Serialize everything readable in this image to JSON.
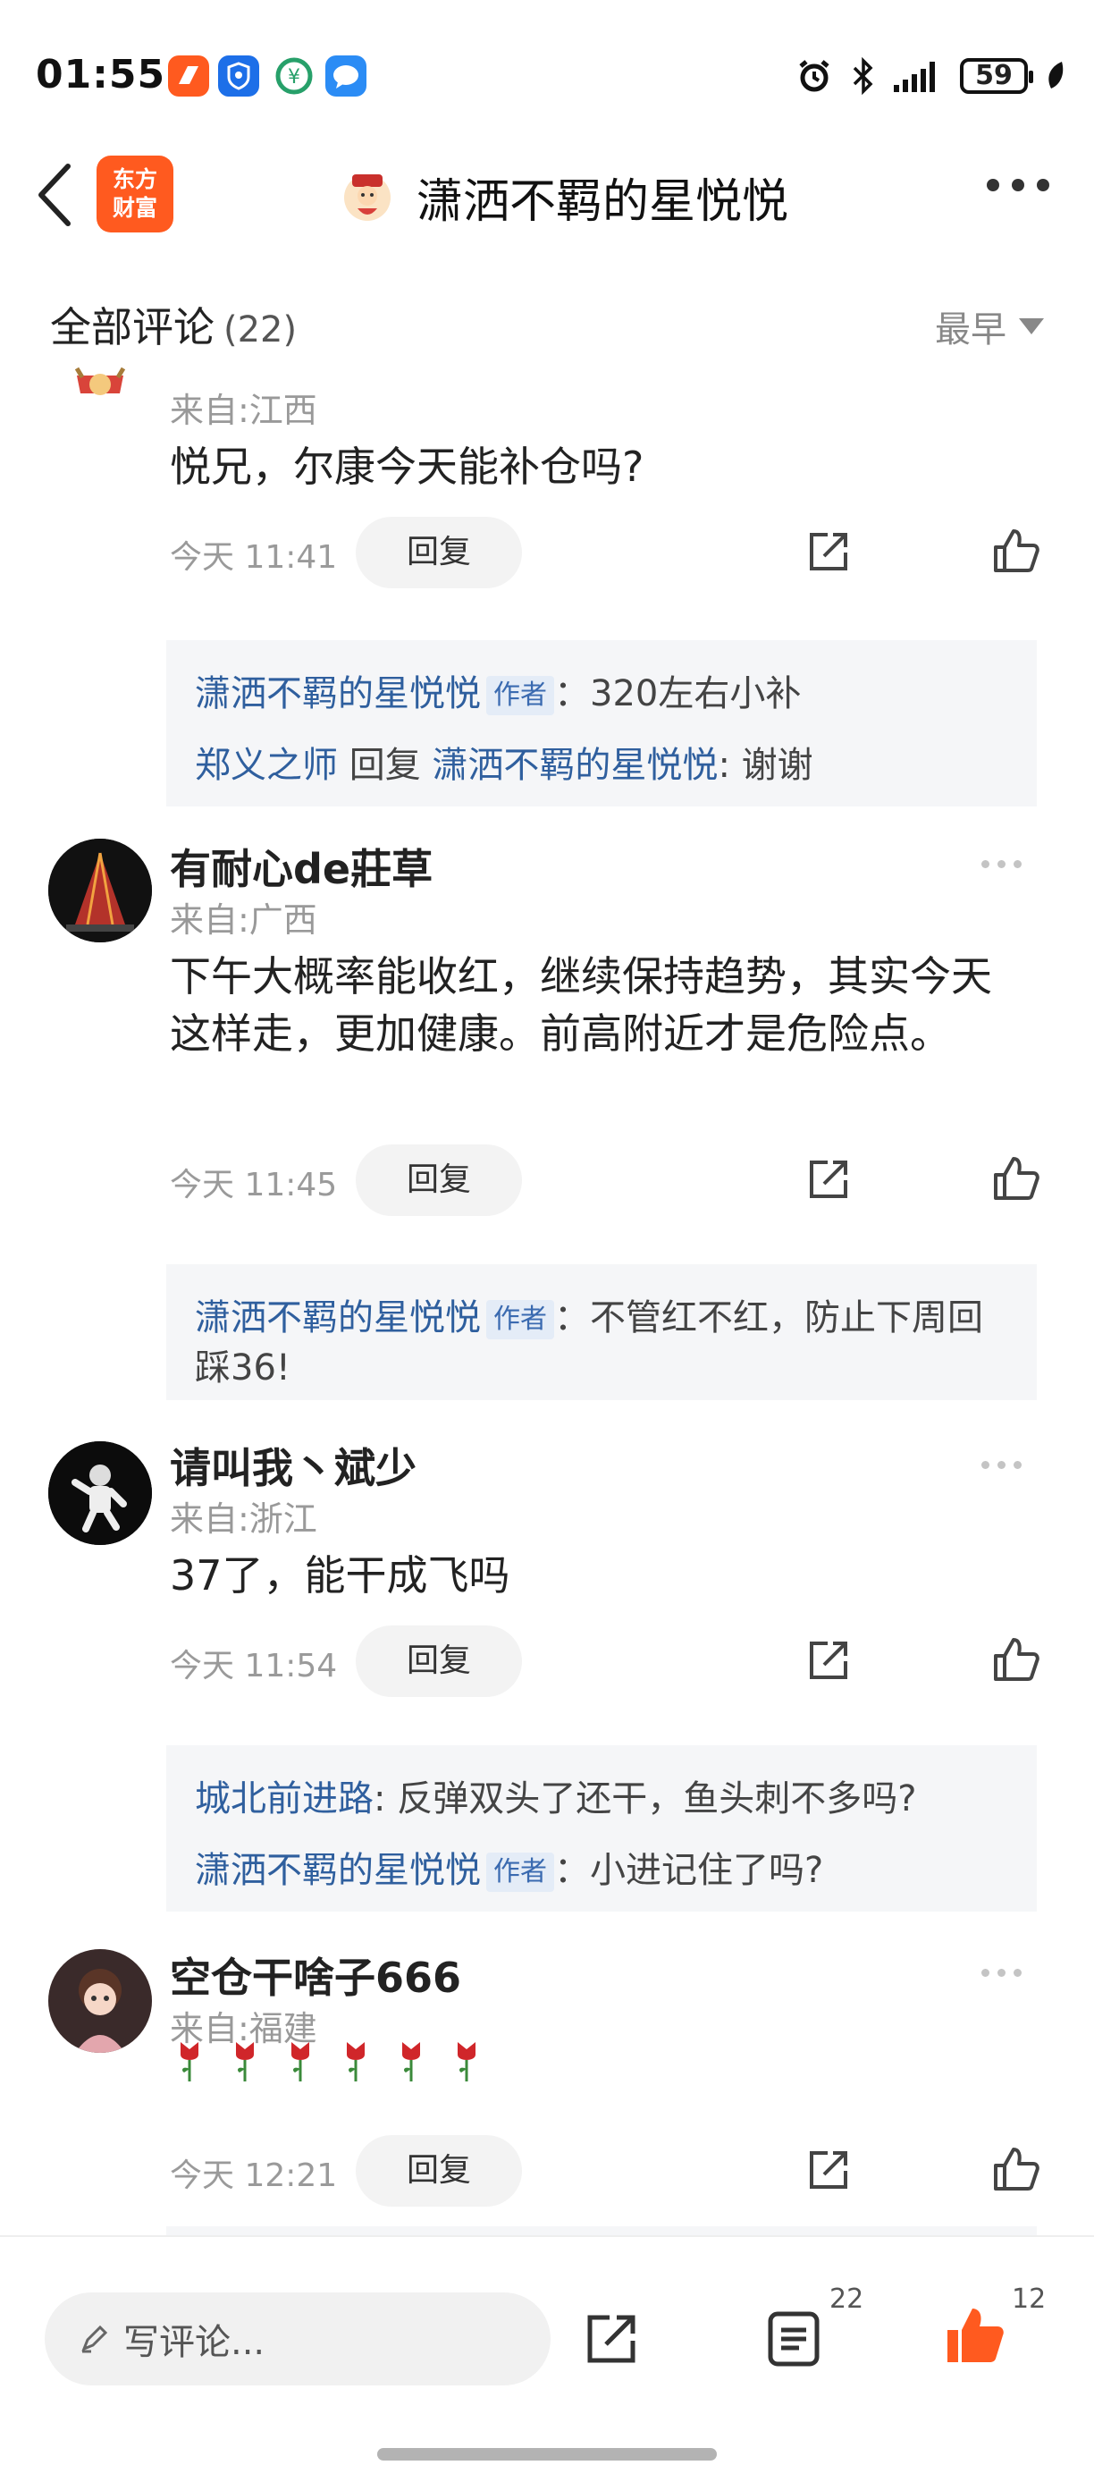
{
  "status": {
    "time": "01:55",
    "battery": "59"
  },
  "header": {
    "brand_line1": "东方",
    "brand_line2": "财富",
    "title": "潇洒不羁的星悦悦"
  },
  "comments_header": {
    "title": "全部评论",
    "count": "(22)",
    "sort_label": "最早"
  },
  "comments": [
    {
      "location": "来自:江西",
      "text": "悦兄，尔康今天能补仓吗?",
      "time": "今天 11:41",
      "reply_label": "回复",
      "replies": [
        {
          "author": "潇洒不羁的星悦悦",
          "tag": "作者",
          "sep": "：",
          "text": "320左右小补"
        },
        {
          "author": "郑义之师",
          "mid": "回复",
          "target": "潇洒不羁的星悦悦",
          "sep": ":",
          "text": "谢谢"
        }
      ]
    },
    {
      "user": "有耐心de莊草",
      "location": "来自:广西",
      "text": "下午大概率能收红，继续保持趋势，其实今天这样走，更加健康。前高附近才是危险点。",
      "time": "今天 11:45",
      "reply_label": "回复",
      "replies": [
        {
          "author": "潇洒不羁的星悦悦",
          "tag": "作者",
          "sep": "：",
          "text": "不管红不红，防止下周回踩36!"
        }
      ]
    },
    {
      "user": "请叫我丶斌少",
      "location": "来自:浙江",
      "text": "37了，能干成飞吗",
      "time": "今天 11:54",
      "reply_label": "回复",
      "replies": [
        {
          "author": "城北前进路",
          "sep": ":",
          "text": "反弹双头了还干，鱼头刺不多吗?"
        },
        {
          "author": "潇洒不羁的星悦悦",
          "tag": "作者",
          "sep": "：",
          "text": "小进记住了吗?"
        }
      ]
    },
    {
      "user": "空仓干啥子666",
      "location": "来自:福建",
      "text": "🌹🌹🌹🌹🌹🌹",
      "time": "今天 12:21",
      "reply_label": "回复"
    }
  ],
  "bottom_bar": {
    "placeholder": "写评论...",
    "comment_count": "22",
    "like_count": "12"
  },
  "colors": {
    "brand": "#ff5a1f",
    "author_link": "#2f5f9e",
    "like_active": "#ff5a1f"
  }
}
